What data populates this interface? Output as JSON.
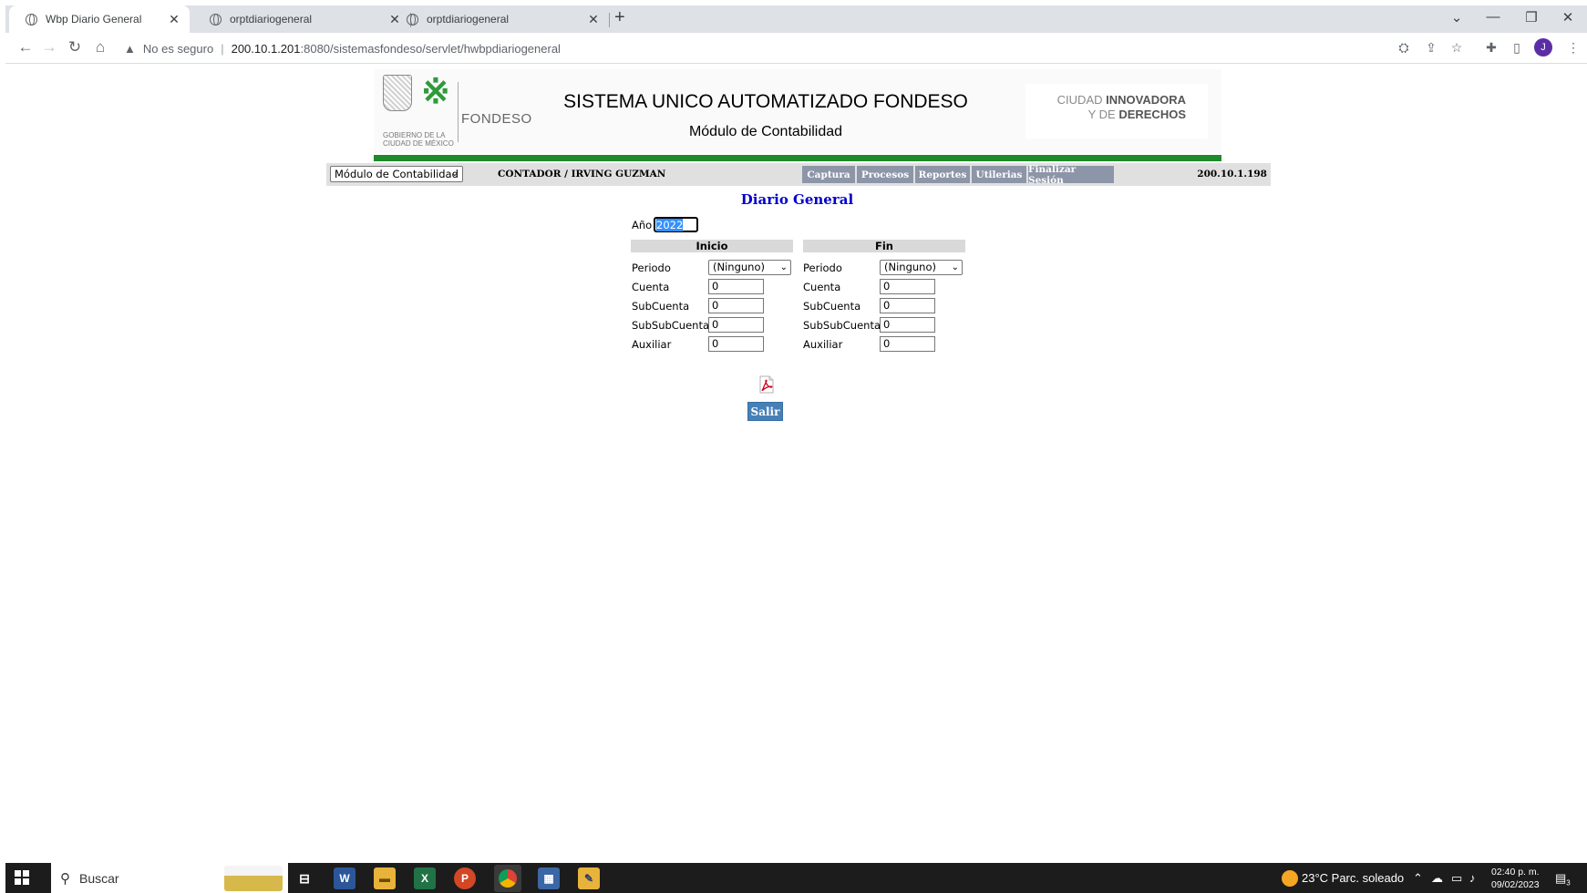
{
  "browser": {
    "tabs": [
      {
        "title": "Wbp Diario General",
        "active": true
      },
      {
        "title": "orptdiariogeneral",
        "active": false
      },
      {
        "title": "orptdiariogeneral",
        "active": false
      }
    ],
    "new_tab": "+",
    "security_label": "No es seguro",
    "url_host": "200.10.1.201",
    "url_path": ":8080/sistemasfondeso/servlet/hwbpdiariogeneral",
    "avatar_letter": "J"
  },
  "banner": {
    "gob_text": "GOBIERNO DE LA CIUDAD DE MÉXICO",
    "brand": "FONDESO",
    "title": "SISTEMA UNICO AUTOMATIZADO FONDESO",
    "subtitle": "Módulo de Contabilidad",
    "slogan_l1_a": "CIUDAD ",
    "slogan_l1_b": "INNOVADORA",
    "slogan_l2_a": "Y DE ",
    "slogan_l2_b": "DERECHOS",
    "accent_color": "#1f8a2a"
  },
  "menubar": {
    "module_select": "Módulo de Contabilidad",
    "user": "CONTADOR / IRVING GUZMAN",
    "items": [
      "Captura",
      "Procesos",
      "Reportes",
      "Utilerias",
      "Finalizar Sesión"
    ],
    "ip": "200.10.1.198"
  },
  "form": {
    "heading": "Diario General",
    "year_label": "Año",
    "year_value": "2022",
    "start": {
      "header": "Inicio",
      "periodo_label": "Periodo",
      "periodo_value": "(Ninguno)",
      "cuenta_label": "Cuenta",
      "cuenta_value": "0",
      "subcuenta_label": "SubCuenta",
      "subcuenta_value": "0",
      "subsubcuenta_label": "SubSubCuenta",
      "subsubcuenta_value": "0",
      "auxiliar_label": "Auxiliar",
      "auxiliar_value": "0"
    },
    "end": {
      "header": "Fin",
      "periodo_label": "Periodo",
      "periodo_value": "(Ninguno)",
      "cuenta_label": "Cuenta",
      "cuenta_value": "0",
      "subcuenta_label": "SubCuenta",
      "subcuenta_value": "0",
      "subsubcuenta_label": "SubSubCuenta",
      "subsubcuenta_value": "0",
      "auxiliar_label": "Auxiliar",
      "auxiliar_value": "0"
    },
    "exit_label": "Salir"
  },
  "taskbar": {
    "search_placeholder": "Buscar",
    "apps": [
      "task-view",
      "word",
      "file-explorer",
      "excel",
      "powerpoint",
      "chrome",
      "calculator",
      "sticky-folder"
    ],
    "weather": "23°C  Parc. soleado",
    "time": "02:40 p. m.",
    "date": "09/02/2023",
    "notifications": "3"
  }
}
